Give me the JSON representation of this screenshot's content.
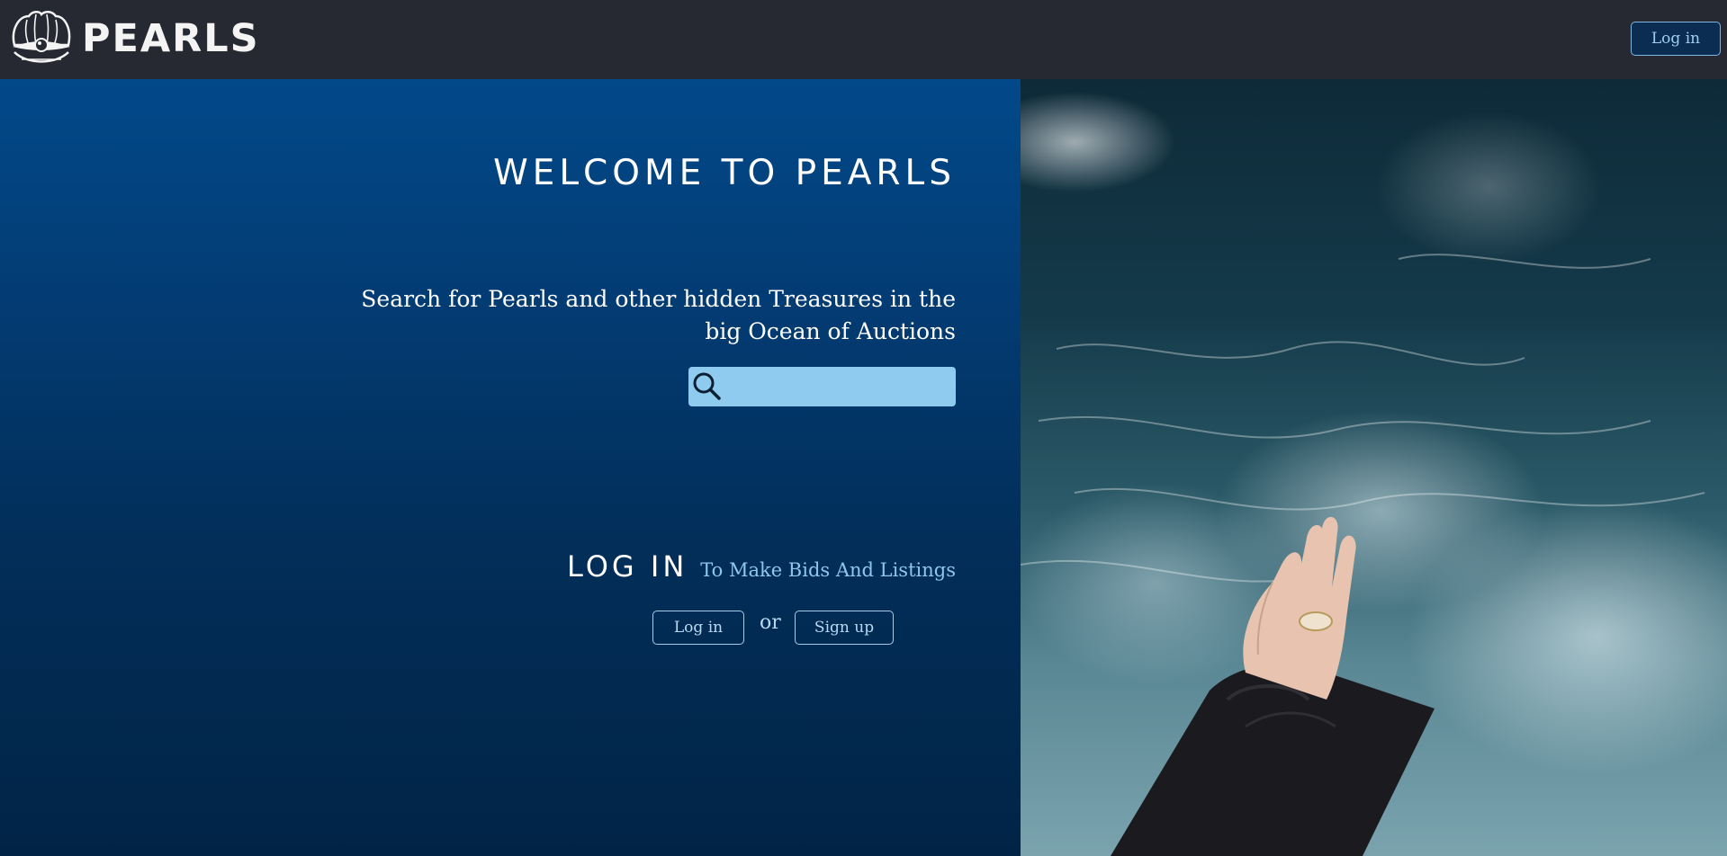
{
  "navbar": {
    "brand": "PEARLS",
    "login_label": "Log in"
  },
  "hero": {
    "title": "WELCOME TO PEARLS",
    "subtitle": "Search for Pearls and other hidden Treasures in the big Ocean of Auctions"
  },
  "search": {
    "icon": "search-icon",
    "value": "",
    "placeholder": ""
  },
  "login_section": {
    "heading": "LOG IN",
    "tagline": "To Make Bids And Listings",
    "login_label": "Log in",
    "or_text": "or",
    "signup_label": "Sign up"
  },
  "colors": {
    "navbar": "#272932",
    "accent": "#8ecbee",
    "panel_top": "#02498a",
    "panel_bottom": "#012446"
  }
}
